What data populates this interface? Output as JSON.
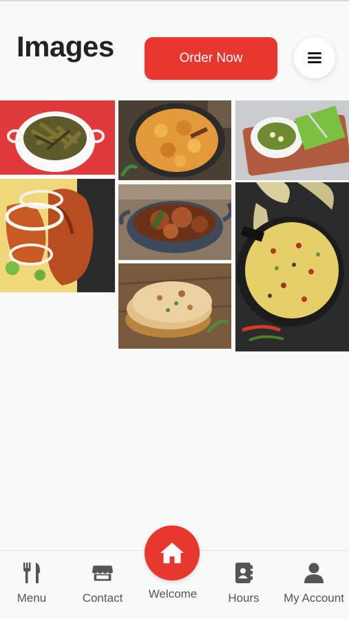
{
  "page": {
    "title": "Images"
  },
  "header": {
    "order_button_label": "Order Now",
    "menu_icon": "hamburger-icon"
  },
  "accent_color": "#e8372f",
  "gallery": {
    "images": [
      {
        "name": "okra-curry-bowl"
      },
      {
        "name": "potato-curry-pan"
      },
      {
        "name": "palak-paneer-plate"
      },
      {
        "name": "grilled-chicken-onions"
      },
      {
        "name": "chicken-kadai"
      },
      {
        "name": "biryani-skillet"
      },
      {
        "name": "naan-stack"
      }
    ]
  },
  "bottom_nav": {
    "items": [
      {
        "label": "Menu",
        "icon": "fork-knife-icon"
      },
      {
        "label": "Contact",
        "icon": "store-icon"
      },
      {
        "label": "Welcome",
        "icon": "home-icon"
      },
      {
        "label": "Hours",
        "icon": "contact-book-icon"
      },
      {
        "label": "My Account",
        "icon": "user-icon"
      }
    ]
  }
}
